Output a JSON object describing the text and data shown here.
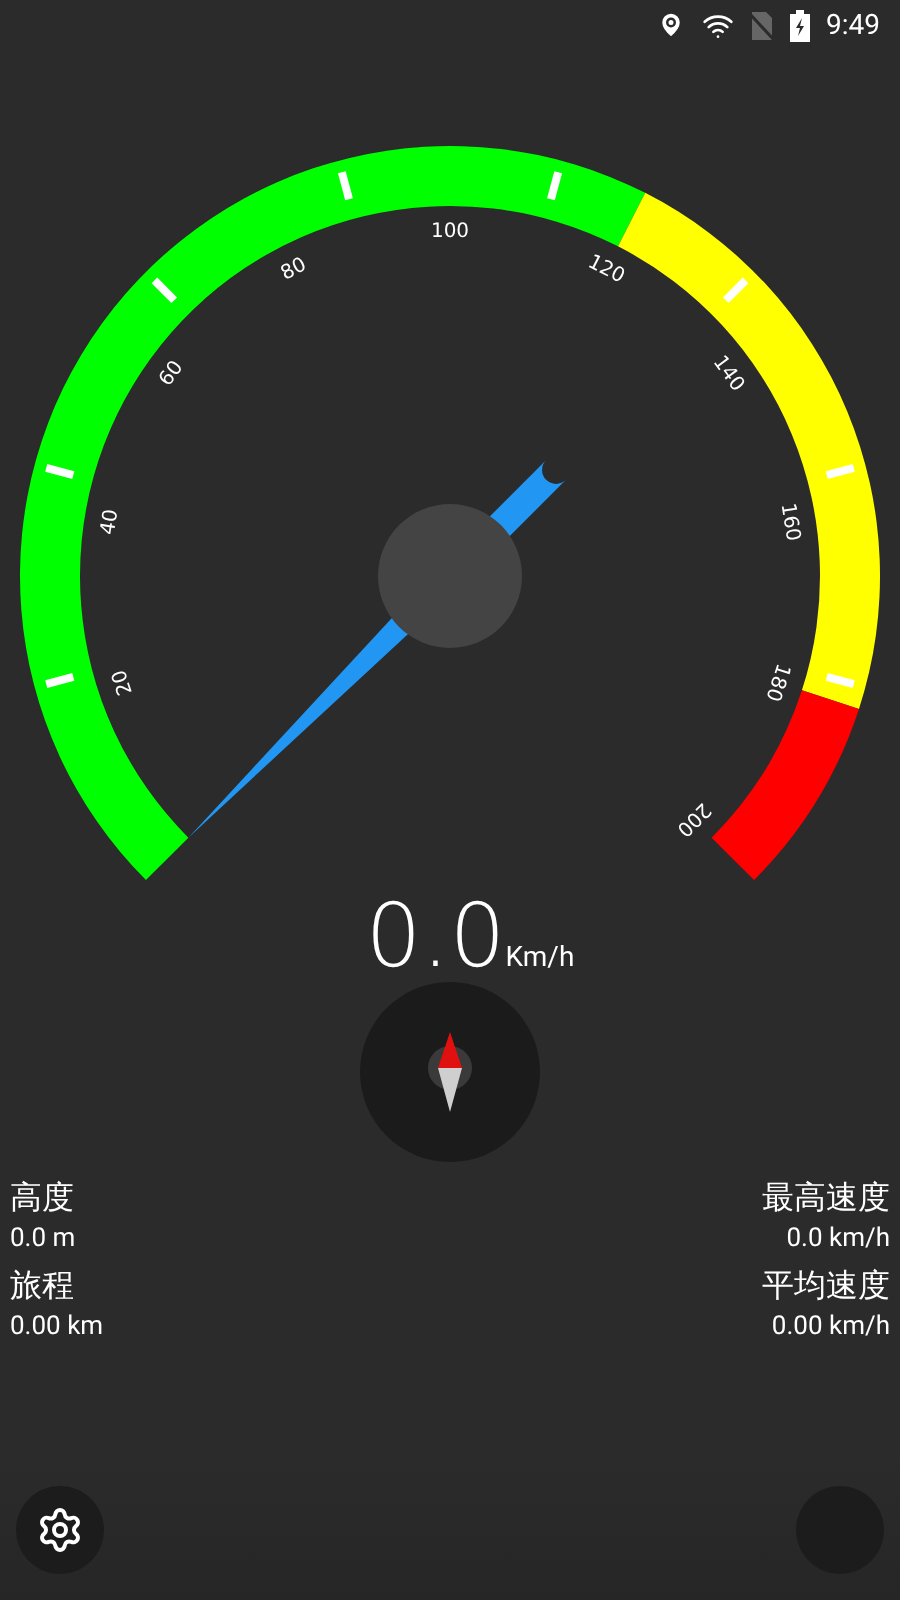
{
  "status_bar": {
    "time": "9:49"
  },
  "gauge": {
    "labels": [
      "20",
      "40",
      "60",
      "80",
      "100",
      "120",
      "140",
      "160",
      "180",
      "200"
    ],
    "zones": [
      {
        "color": "#00ff00"
      },
      {
        "color": "#ffff00"
      },
      {
        "color": "#ff0000"
      }
    ]
  },
  "speed": {
    "value": "0.0",
    "unit": "Km/h"
  },
  "stats": [
    {
      "label": "高度",
      "value": "0.0 m"
    },
    {
      "label": "最高速度",
      "value": "0.0 km/h"
    },
    {
      "label": "旅程",
      "value": "0.00 km"
    },
    {
      "label": "平均速度",
      "value": "0.00 km/h"
    }
  ]
}
